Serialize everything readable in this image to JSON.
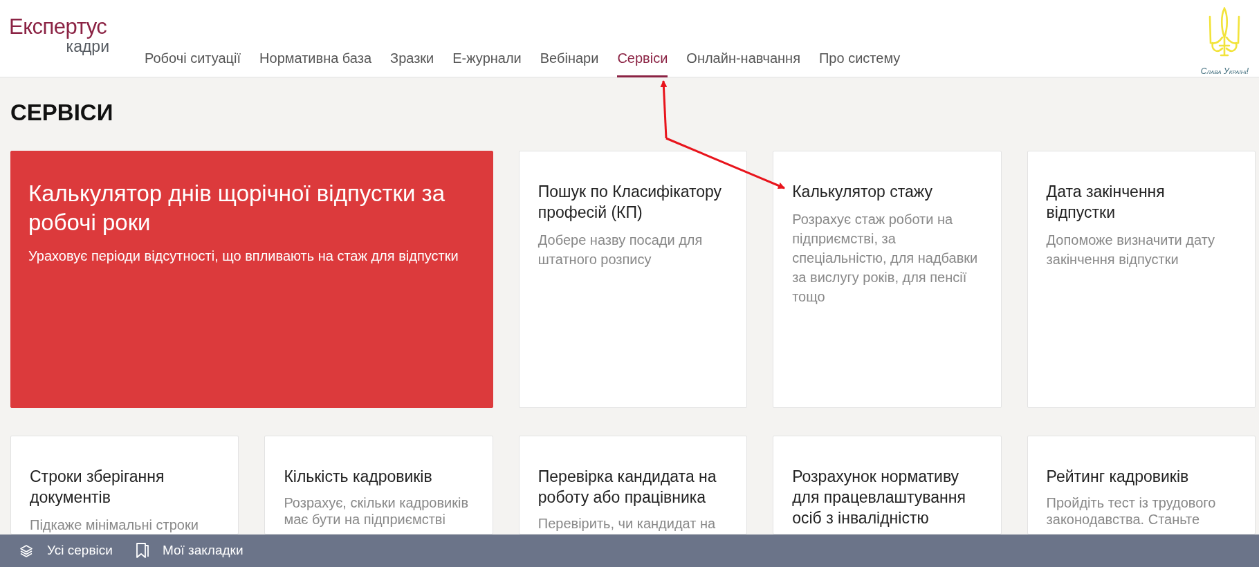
{
  "logo": {
    "name": "Експертус",
    "subtitle": "кадри"
  },
  "nav": [
    {
      "label": "Робочі ситуації",
      "selected": false
    },
    {
      "label": "Нормативна база",
      "selected": false
    },
    {
      "label": "Зразки",
      "selected": false
    },
    {
      "label": "Е-журнали",
      "selected": false
    },
    {
      "label": "Вебінари",
      "selected": false
    },
    {
      "label": "Сервіси",
      "selected": true
    },
    {
      "label": "Онлайн-навчання",
      "selected": false
    },
    {
      "label": "Про систему",
      "selected": false
    }
  ],
  "emblem": {
    "caption": "Слава Україні!"
  },
  "page_title": "СЕРВІСИ",
  "cards": [
    {
      "kind": "featured",
      "title": "Калькулятор днів щорічної відпустки за робочі роки",
      "description": "Ураховує періоди відсутності, що впливають на стаж для відпустки"
    },
    {
      "kind": "regular",
      "title": "Пошук по Класифікатору професій (КП)",
      "description": "Добере назву посади для штатного розпису"
    },
    {
      "kind": "regular",
      "title": "Калькулятор стажу",
      "description": "Розрахує стаж роботи на підприємстві, за спеціальністю, для надбавки за вислугу років, для пенсії тощо"
    },
    {
      "kind": "regular",
      "title": "Дата закінчення відпустки",
      "description": "Допоможе визначити дату закінчення відпустки"
    },
    {
      "kind": "regular",
      "title": "Строки зберігання документів",
      "description": "Підкаже мінімальні строки"
    },
    {
      "kind": "regular",
      "title": "Кількість кадровиків",
      "description": "Розрахує, скільки кадровиків має бути на підприємстві"
    },
    {
      "kind": "regular",
      "title": "Перевірка кандидата на роботу або працівника",
      "description": "Перевірить, чи кандидат на"
    },
    {
      "kind": "regular",
      "title": "Розрахунок нормативу для працевлаштування осіб з інвалідністю"
    },
    {
      "kind": "regular",
      "title": "Рейтинг кадровиків",
      "description": "Пройдіть тест із трудового законодавства. Станьте"
    }
  ],
  "bottom_bar": [
    {
      "kind": "layers",
      "label": "Усі сервіси"
    },
    {
      "kind": "bookmark",
      "label": "Мої закладки"
    }
  ]
}
